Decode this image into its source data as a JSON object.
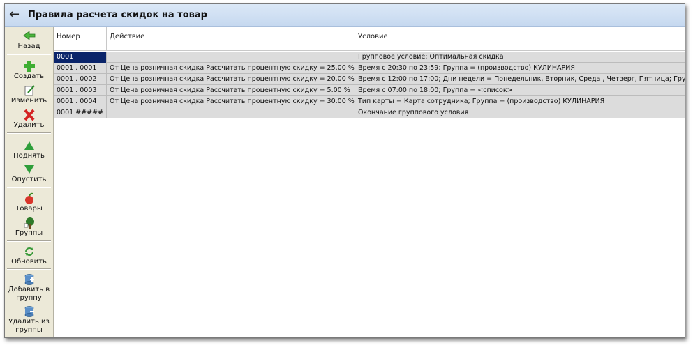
{
  "window": {
    "title": "Правила расчета скидок на товар"
  },
  "sidebar": {
    "back": "Назад",
    "create": "Создать",
    "edit": "Изменить",
    "delete": "Удалить",
    "move_up": "Поднять",
    "move_down": "Опустить",
    "goods": "Товары",
    "groups": "Группы",
    "refresh": "Обновить",
    "add_to_group": "Добавить в группу",
    "remove_from_group": "Удалить из группы"
  },
  "table": {
    "columns": [
      "Номер",
      "Действие",
      "Условие"
    ],
    "rows": [
      {
        "number": "0001",
        "action": "",
        "condition": "Групповое условие: Оптимальная скидка"
      },
      {
        "number": "0001 . 0001",
        "action": "От Цена розничная скидка Рассчитать процентную скидку = 25.00 %",
        "condition": "Время с 20:30 по 23:59; Группа = (производство) КУЛИНАРИЯ"
      },
      {
        "number": "0001 . 0002",
        "action": "От Цена розничная скидка Рассчитать процентную скидку = 20.00 %",
        "condition": "Время с 12:00 по 17:00; Дни недели = Понедельник, Вторник, Среда , Четверг, Пятница; Гру..."
      },
      {
        "number": "0001 . 0003",
        "action": "От Цена розничная скидка Рассчитать процентную скидку = 5.00 %",
        "condition": "Время с 07:00 по 18:00; Группа = <список>"
      },
      {
        "number": "0001 . 0004",
        "action": "От Цена розничная скидка Рассчитать процентную скидку = 30.00 %",
        "condition": "Тип карты = Карта сотрудника; Группа = (производство) КУЛИНАРИЯ"
      },
      {
        "number": "0001 #####",
        "action": "",
        "condition": "Окончание группового условия"
      }
    ]
  },
  "colors": {
    "titlebar": "#c5d8ef",
    "selection": "#0a246a",
    "row": "#dcdcdc",
    "panel": "#ece9d8"
  }
}
